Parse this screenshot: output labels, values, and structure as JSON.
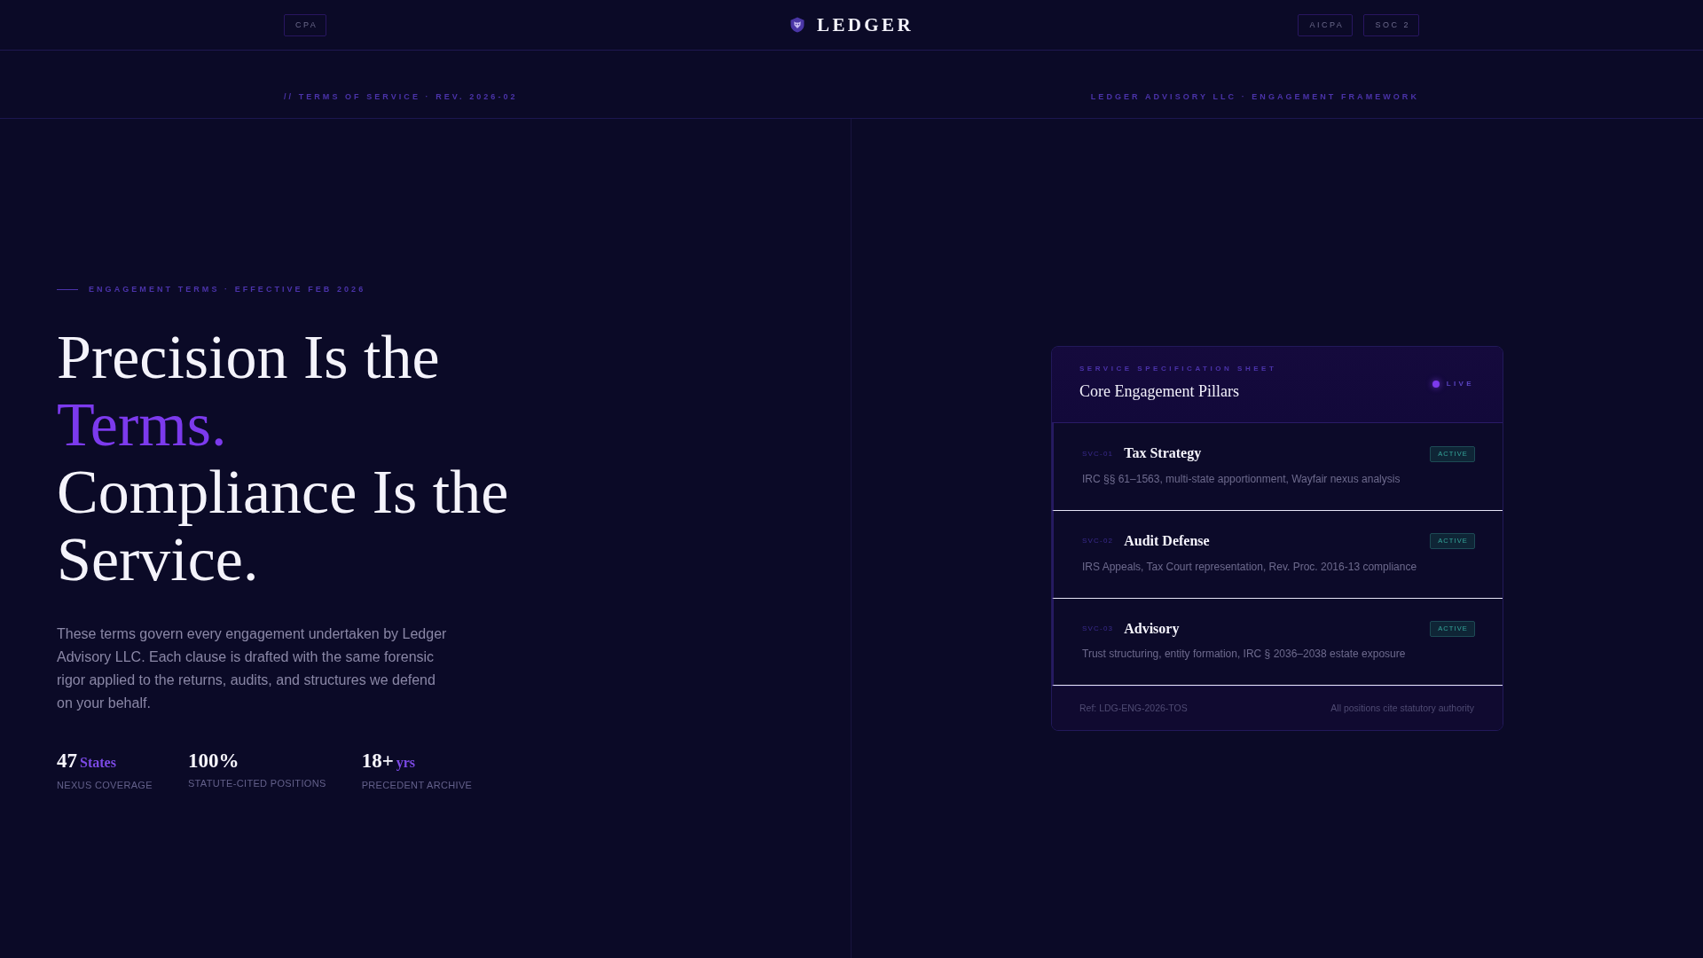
{
  "header": {
    "left_badges": [
      {
        "label": "CPA"
      }
    ],
    "brand": "LEDGER",
    "right_badges": [
      {
        "label": "AICPA"
      },
      {
        "label": "SOC 2"
      }
    ]
  },
  "subheader": {
    "left": "// TERMS OF SERVICE · REV. 2026-02",
    "right": "LEDGER ADVISORY LLC · ENGAGEMENT FRAMEWORK"
  },
  "hero": {
    "eyebrow": "ENGAGEMENT TERMS · EFFECTIVE FEB 2026",
    "headline": [
      {
        "text": "Precision Is the",
        "accent": false
      },
      {
        "text": "Terms.",
        "accent": true
      },
      {
        "text": "Compliance Is the Service.",
        "accent": false
      }
    ],
    "intro": "These terms govern every engagement undertaken by Ledger Advisory LLC. Each clause is drafted with the same forensic rigor applied to the returns, audits, and structures we defend on your behalf.",
    "stats": [
      {
        "value": "47",
        "unit": "States",
        "label": "NEXUS COVERAGE"
      },
      {
        "value": "100%",
        "label": "STATUTE-CITED POSITIONS"
      },
      {
        "value": "18+",
        "unit": "yrs",
        "label": "PRECEDENT ARCHIVE"
      }
    ]
  },
  "spec_sheet": {
    "eyebrow": "SERVICE SPECIFICATION SHEET",
    "title": "Core Engagement Pillars",
    "status": "LIVE",
    "services": [
      {
        "code": "SVC-01",
        "name": "Tax Strategy",
        "status": "ACTIVE",
        "description": "IRC §§ 61–1563, multi-state apportionment, Wayfair nexus analysis"
      },
      {
        "code": "SVC-02",
        "name": "Audit Defense",
        "status": "ACTIVE",
        "description": "IRS Appeals, Tax Court representation, Rev. Proc. 2016-13 compliance"
      },
      {
        "code": "SVC-03",
        "name": "Advisory",
        "status": "ACTIVE",
        "description": "Trust structuring, entity formation, IRC § 2036–2038 estate exposure"
      }
    ],
    "footer_left": "Ref: LDG-ENG-2026-TOS",
    "footer_right": "All positions cite statutory authority"
  }
}
